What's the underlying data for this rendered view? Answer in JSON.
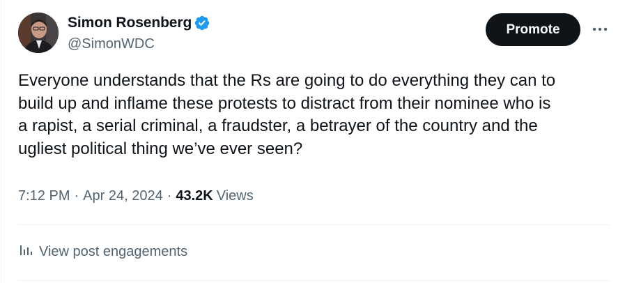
{
  "author": {
    "display_name": "Simon Rosenberg",
    "handle": "@SimonWDC",
    "verified": true,
    "verified_color": "#1d9bf0"
  },
  "header": {
    "promote_label": "Promote",
    "more_icon": "more-horizontal-icon"
  },
  "tweet": {
    "lines": [
      "Everyone understands that the Rs are going to do everything they can to",
      "build up and inflame these protests to distract from their nominee who is",
      "a rapist, a serial criminal, a fraudster, a betrayer of the country and the",
      "ugliest political thing we’ve ever seen?"
    ]
  },
  "meta": {
    "time": "7:12 PM",
    "separator": "·",
    "date": "Apr 24, 2024",
    "views_count": "43.2K",
    "views_label": "Views"
  },
  "engagements": {
    "icon": "analytics-icon",
    "label": "View post engagements"
  },
  "colors": {
    "text_primary": "#0f1419",
    "text_secondary": "#536471",
    "divider": "#eff3f4",
    "button_bg": "#0f1419"
  }
}
